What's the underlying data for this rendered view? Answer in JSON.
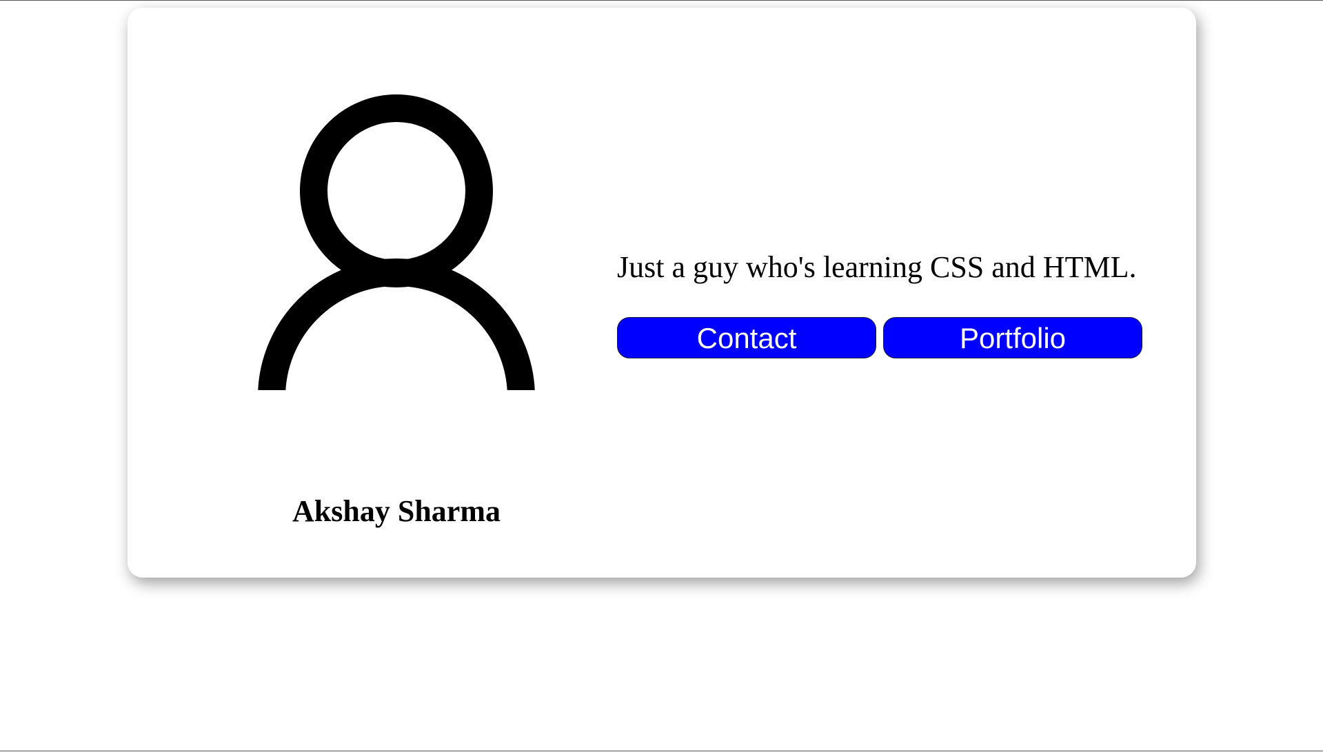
{
  "profile": {
    "name": "Akshay Sharma",
    "bio": "Just a guy who's learning CSS and HTML.",
    "avatar_icon": "user-icon"
  },
  "actions": {
    "contact_label": "Contact",
    "portfolio_label": "Portfolio"
  },
  "colors": {
    "button_bg": "#0000ff",
    "button_text": "#ffffff",
    "card_bg": "#ffffff"
  }
}
